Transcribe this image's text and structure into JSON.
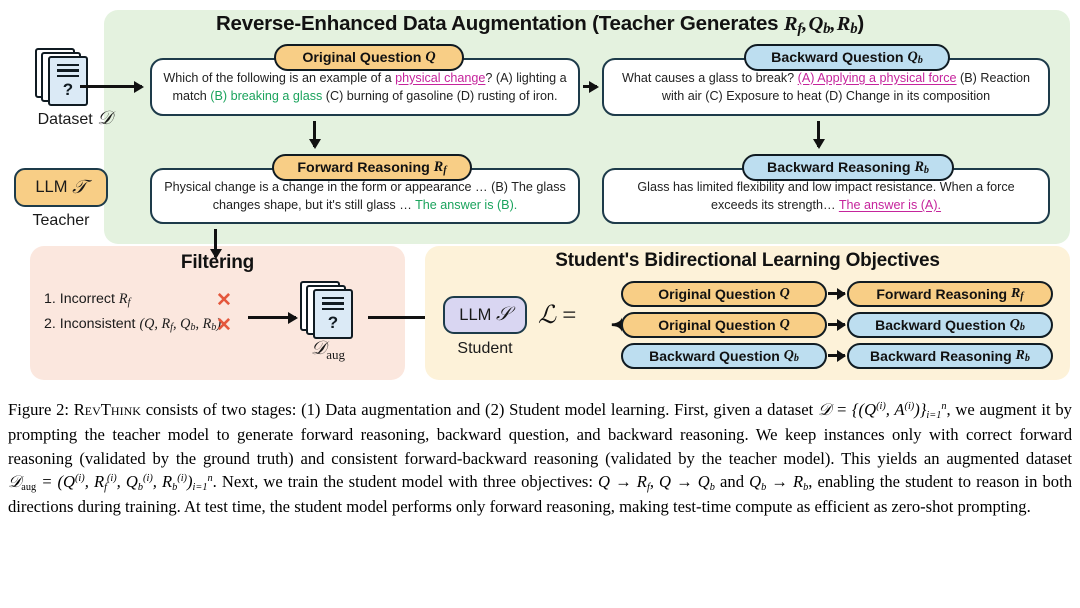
{
  "figure": {
    "number": "Figure 2:",
    "method_name": "RevThink"
  },
  "stage1": {
    "title_prefix": "Reverse-Enhanced Data Augmentation (Teacher Generates ",
    "title_symbols": "R_f, Q_b, R_b",
    "title_suffix": ")",
    "panel_color": "#e4f2df"
  },
  "dataset": {
    "icon": "document-stack-question-icon",
    "caption": "Dataset D"
  },
  "teacher": {
    "box_label": "LLM T",
    "caption": "Teacher",
    "box_color": "#f8ce86"
  },
  "student": {
    "box_label": "LLM S",
    "caption": "Student",
    "box_color": "#d9d6f2"
  },
  "boxes": {
    "original_question": {
      "pill_label": "Original Question Q",
      "pill_color": "#f8ce86",
      "text_parts": [
        {
          "t": "Which of the following is an example of a ",
          "style": "plain"
        },
        {
          "t": "physical change",
          "style": "magenta-underline"
        },
        {
          "t": "? (A) lighting a match ",
          "style": "plain"
        },
        {
          "t": "(B) breaking a glass",
          "style": "green"
        },
        {
          "t": " (C) burning of gasoline (D) rusting of iron.",
          "style": "plain"
        }
      ]
    },
    "backward_question": {
      "pill_label": "Backward Question Q_b",
      "pill_color": "#bddef0",
      "text_parts": [
        {
          "t": "What causes a glass to break? ",
          "style": "plain"
        },
        {
          "t": "(A) Applying a physical force",
          "style": "magenta-underline"
        },
        {
          "t": " (B) Reaction with air (C) Exposure to heat (D) Change in its composition",
          "style": "plain"
        }
      ]
    },
    "forward_reasoning": {
      "pill_label": "Forward Reasoning R_f",
      "pill_color": "#f8ce86",
      "text_parts": [
        {
          "t": "Physical change is a change in the form or appearance … (B) The glass changes shape, but it's still glass … ",
          "style": "plain"
        },
        {
          "t": "The answer is (B).",
          "style": "green"
        }
      ]
    },
    "backward_reasoning": {
      "pill_label": "Backward Reasoning R_b",
      "pill_color": "#bddef0",
      "text_parts": [
        {
          "t": "Glass has limited flexibility and low impact resistance. When a force exceeds its strength… ",
          "style": "plain"
        },
        {
          "t": "The answer is (A).",
          "style": "magenta-underline"
        }
      ]
    }
  },
  "filtering": {
    "title": "Filtering",
    "panel_color": "#fbe7de",
    "items": [
      {
        "label": "1. Incorrect R_f",
        "mark": "×"
      },
      {
        "label": "2. Inconsistent (Q, R_f, Q_b, R_b)",
        "mark": "×"
      }
    ],
    "mark_color": "#e4573c",
    "output_icon_caption": "D_aug"
  },
  "objectives": {
    "title": "Student's Bidirectional Learning Objectives",
    "panel_color": "#fdf2d9",
    "loss_symbol": "L =",
    "rows": [
      {
        "left": "Original Question Q",
        "left_color": "#f8ce86",
        "right": "Forward Reasoning R_f",
        "right_color": "#f8ce86"
      },
      {
        "left": "Original Question Q",
        "left_color": "#f8ce86",
        "right": "Backward Question Q_b",
        "right_color": "#bddef0"
      },
      {
        "left": "Backward Question Q_b",
        "left_color": "#bddef0",
        "right": "Backward Reasoning R_b",
        "right_color": "#bddef0"
      }
    ]
  },
  "caption": {
    "p1": "consists of two stages: (1) Data augmentation and (2) Student model learning. First, given a dataset",
    "p2": ", we augment it by prompting the teacher model to generate forward reasoning, backward question, and backward reasoning. We keep instances only with correct forward reasoning (validated by the ground truth) and consistent forward-backward reasoning (validated by the teacher model). This yields an augmented dataset",
    "p3": ". Next, we train the student model with three objectives:",
    "p4": ", enabling the student to reason in both directions during training. At test time, the student model performs only forward reasoning, making test-time compute as efficient as zero-shot prompting."
  }
}
